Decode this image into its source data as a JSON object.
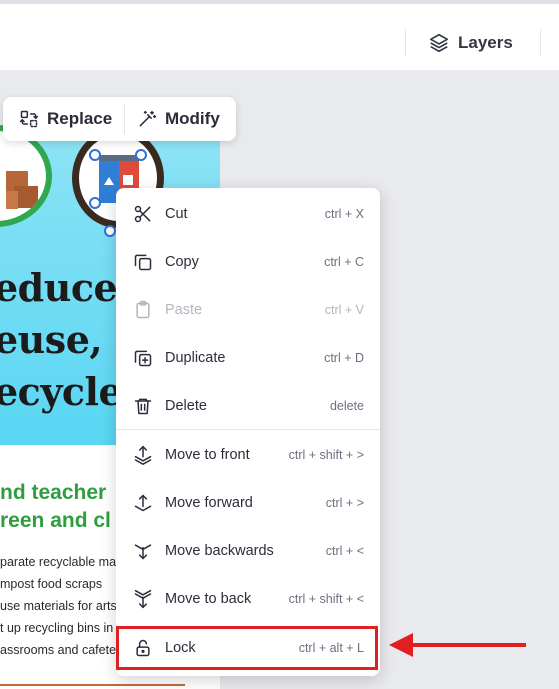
{
  "topbar": {
    "layers_label": "Layers"
  },
  "toolbar": {
    "replace_label": "Replace",
    "modify_label": "Modify"
  },
  "canvas": {
    "hero_lines": [
      "educe,",
      "euse,",
      "ecycle!"
    ],
    "subheading_lines": [
      "nd teacher",
      "reen and cl"
    ],
    "list_items": [
      "parate recyclable ma",
      "mpost food scraps",
      "use materials for arts",
      "t up recycling bins in",
      "assrooms and cafeter"
    ]
  },
  "context_menu": {
    "items": [
      {
        "label": "Cut",
        "shortcut": "ctrl + X",
        "icon": "scissors-icon"
      },
      {
        "label": "Copy",
        "shortcut": "ctrl + C",
        "icon": "copy-icon"
      },
      {
        "label": "Paste",
        "shortcut": "ctrl + V",
        "icon": "clipboard-icon",
        "disabled": true
      },
      {
        "label": "Duplicate",
        "shortcut": "ctrl + D",
        "icon": "duplicate-icon"
      },
      {
        "label": "Delete",
        "shortcut": "delete",
        "icon": "trash-icon"
      },
      {
        "label": "Move to front",
        "shortcut": "ctrl + shift + >",
        "icon": "move-to-front-icon"
      },
      {
        "label": "Move forward",
        "shortcut": "ctrl + >",
        "icon": "move-forward-icon"
      },
      {
        "label": "Move backwards",
        "shortcut": "ctrl + <",
        "icon": "move-backward-icon"
      },
      {
        "label": "Move to back",
        "shortcut": "ctrl + shift + <",
        "icon": "move-to-back-icon"
      },
      {
        "label": "Lock",
        "shortcut": "ctrl + alt + L",
        "icon": "lock-icon"
      }
    ]
  },
  "colors": {
    "highlight": "#e02020",
    "green_text": "#2f9e3f",
    "hero_bg": "#58d6f3"
  }
}
